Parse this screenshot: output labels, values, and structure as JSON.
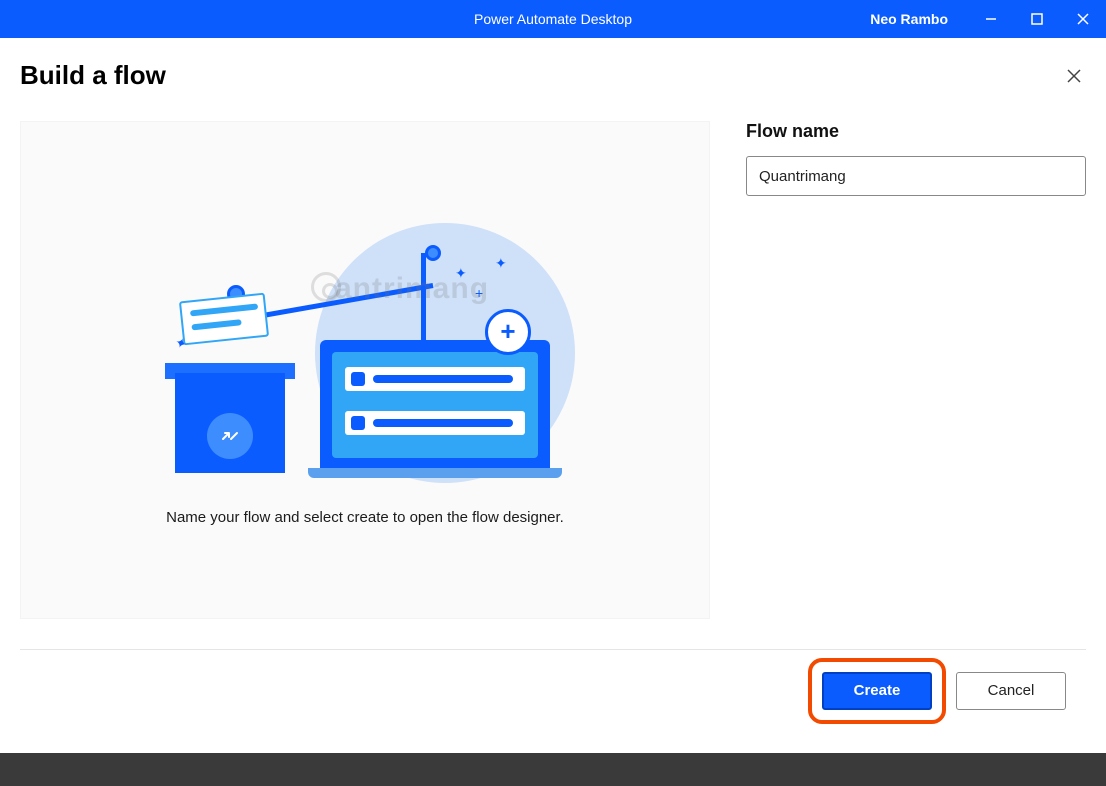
{
  "titlebar": {
    "app_title": "Power Automate Desktop",
    "user_name": "Neo Rambo"
  },
  "dialog": {
    "title": "Build a flow",
    "preview_text": "Name your flow and select create to open the flow designer.",
    "watermark_text": "antrimang"
  },
  "form": {
    "flow_name_label": "Flow name",
    "flow_name_value": "Quantrimang"
  },
  "footer": {
    "create_label": "Create",
    "cancel_label": "Cancel"
  }
}
